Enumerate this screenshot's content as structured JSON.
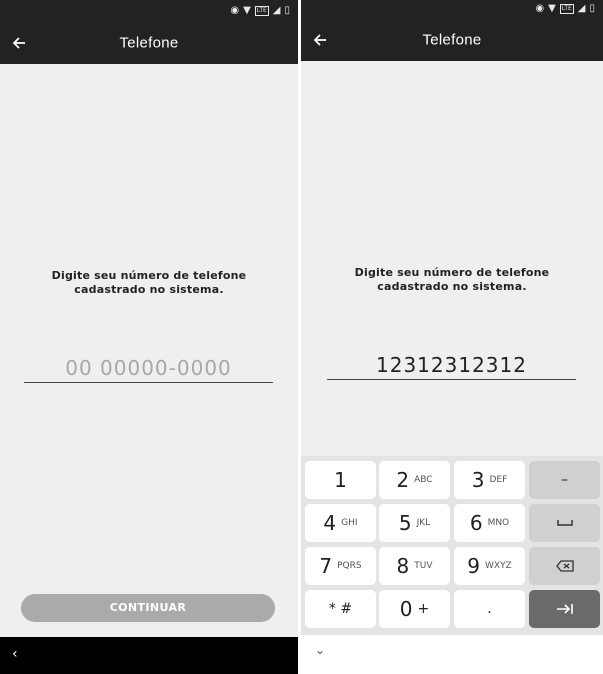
{
  "left": {
    "status_icons": [
      "eye-icon",
      "wifi-icon",
      "lte-icon",
      "signal-icon",
      "battery-icon"
    ],
    "lte_label": "LTE",
    "title": "Telefone",
    "prompt": "Digite seu número de telefone cadastrado no sistema.",
    "phone_placeholder": "00 00000-0000",
    "continue_label": "CONTINUAR",
    "continue_enabled": false
  },
  "right": {
    "status_icons": [
      "eye-icon",
      "wifi-icon",
      "lte-icon",
      "signal-icon",
      "battery-icon"
    ],
    "lte_label": "LTE",
    "title": "Telefone",
    "prompt": "Digite seu número de telefone cadastrado no sistema.",
    "phone_value": "12312312312",
    "keyboard": {
      "k1": {
        "digit": "1",
        "letters": ""
      },
      "k2": {
        "digit": "2",
        "letters": "ABC"
      },
      "k3": {
        "digit": "3",
        "letters": "DEF"
      },
      "k4": {
        "digit": "4",
        "letters": "GHI"
      },
      "k5": {
        "digit": "5",
        "letters": "JKL"
      },
      "k6": {
        "digit": "6",
        "letters": "MNO"
      },
      "k7": {
        "digit": "7",
        "letters": "PQRS"
      },
      "k8": {
        "digit": "8",
        "letters": "TUV"
      },
      "k9": {
        "digit": "9",
        "letters": "WXYZ"
      },
      "k0": {
        "digit": "0",
        "letters": "+"
      },
      "star_hash": "* #",
      "dot": ".",
      "minus": "–"
    }
  },
  "colors": {
    "appbar": "#222222",
    "background": "#efefef",
    "button_disabled": "#aaaaaa",
    "action_key": "#6a6a6a"
  }
}
